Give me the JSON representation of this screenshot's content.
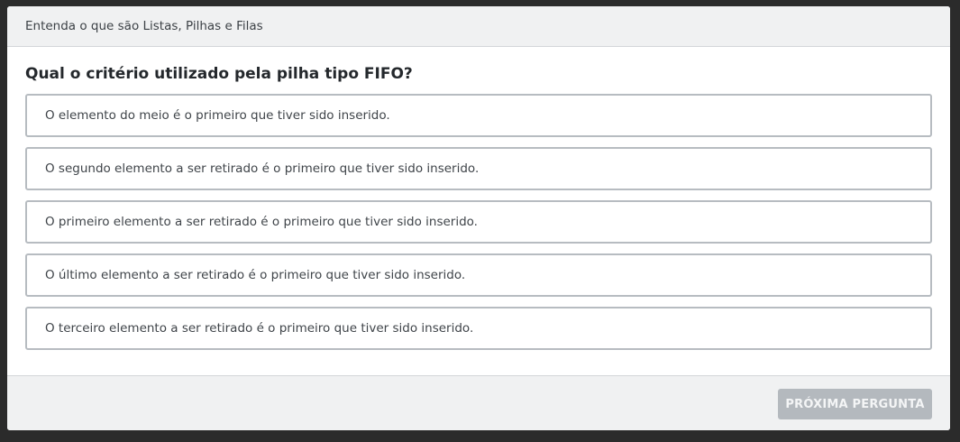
{
  "header": {
    "course_title": "Entenda o que são Listas, Pilhas e Filas"
  },
  "question": {
    "text": "Qual o critério utilizado pela pilha tipo FIFO?",
    "options": [
      "O elemento do meio é o primeiro que tiver sido inserido.",
      "O segundo elemento a ser retirado é o primeiro que tiver sido inserido.",
      "O primeiro elemento a ser retirado é o primeiro que tiver sido inserido.",
      "O último elemento a ser retirado é o primeiro que tiver sido inserido.",
      "O terceiro elemento a ser retirado é o primeiro que tiver sido inserido."
    ]
  },
  "footer": {
    "next_label": "PRÓXIMA PERGUNTA",
    "next_enabled": false
  },
  "colors": {
    "background": "#2b2b2b",
    "card": "#ffffff",
    "header_bg": "#f0f1f2",
    "option_border": "#b7bcc1",
    "button_disabled": "#b4b9be"
  }
}
